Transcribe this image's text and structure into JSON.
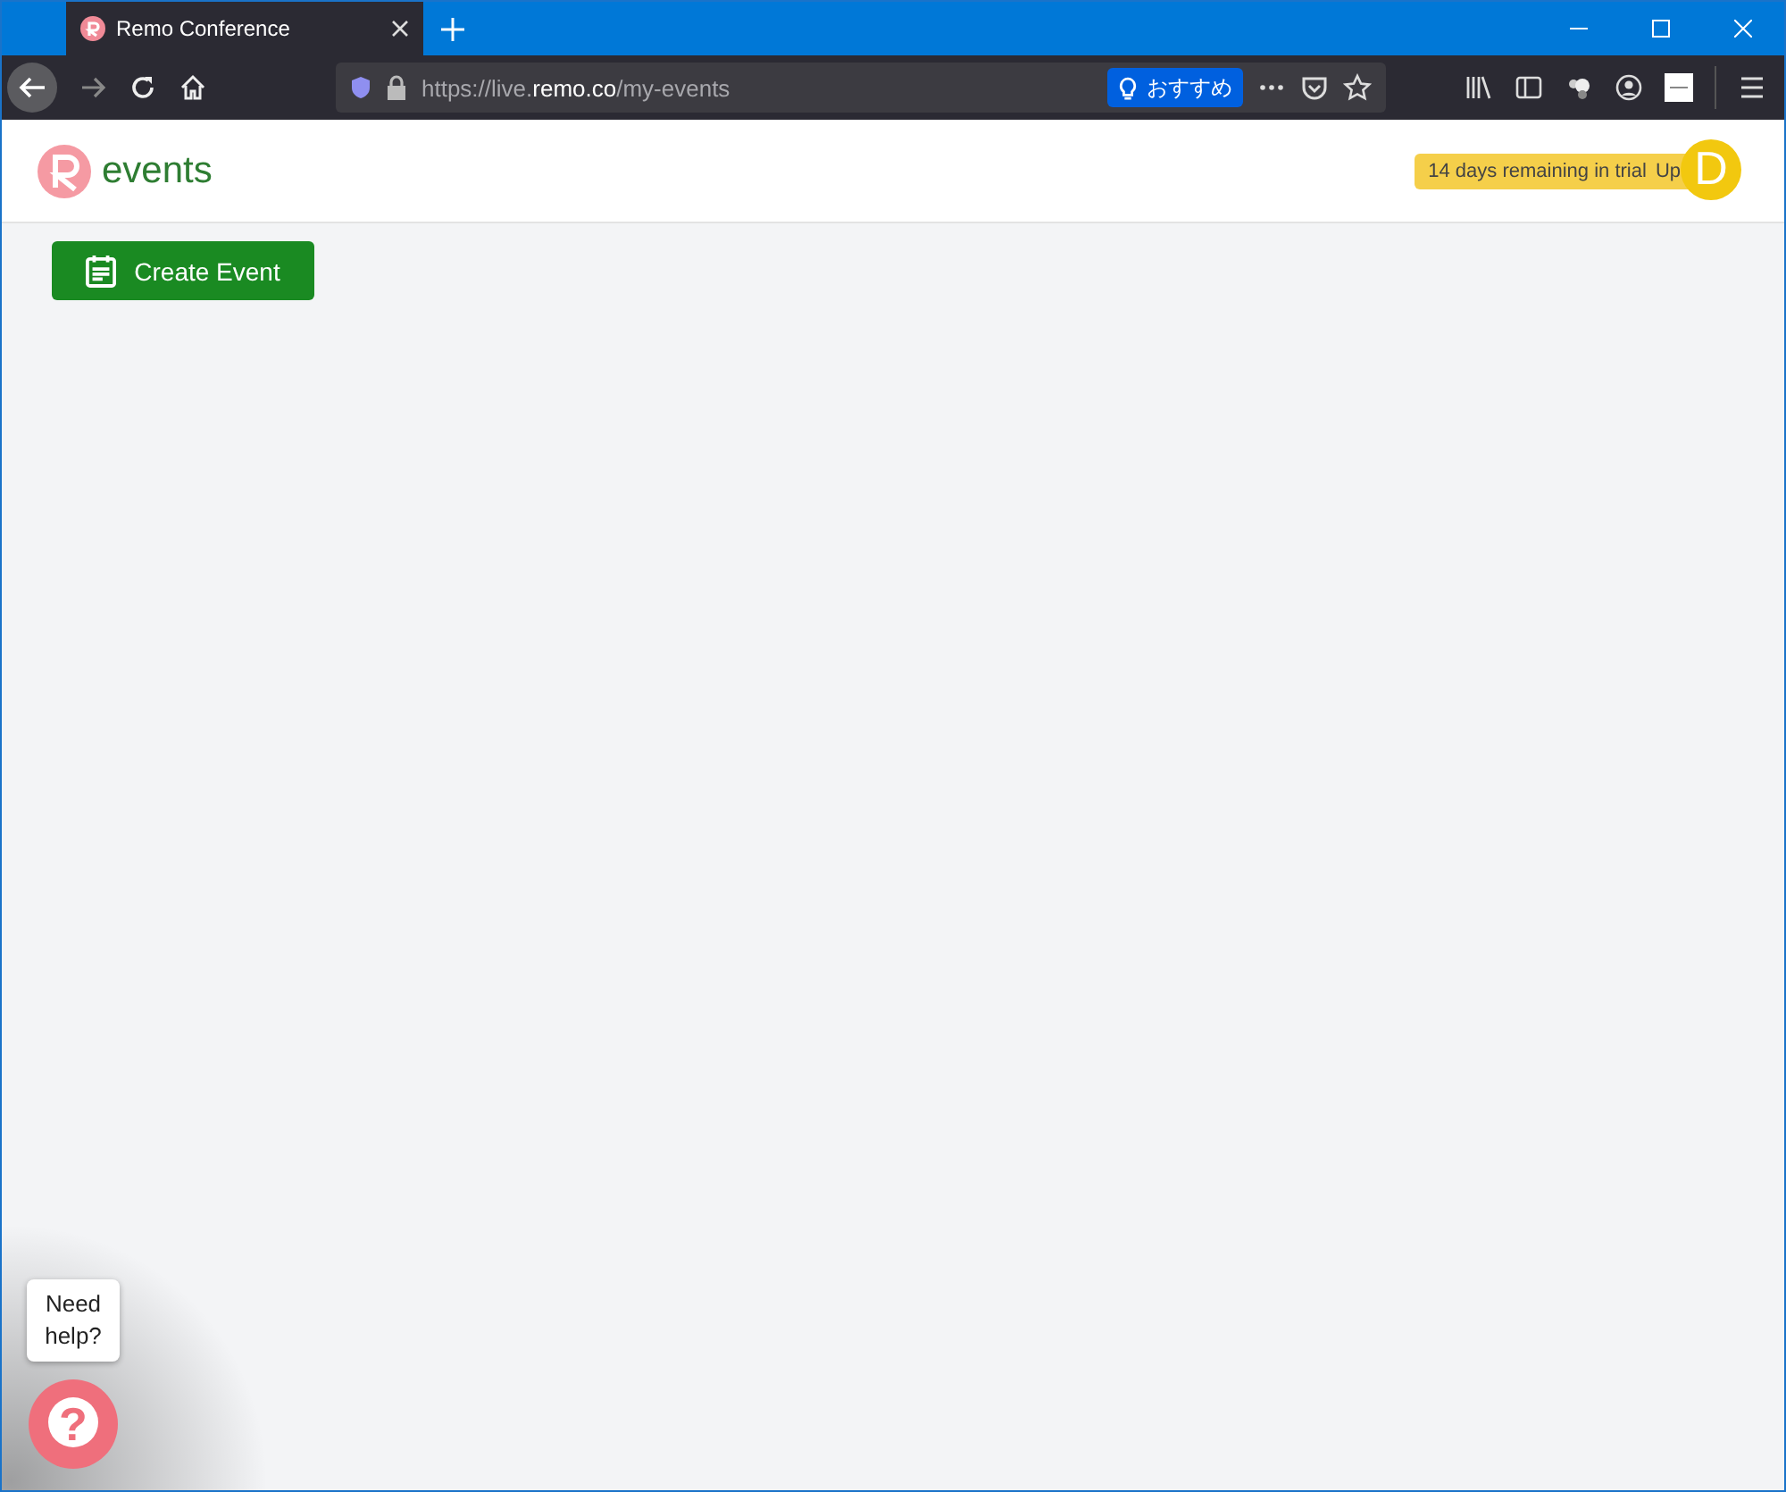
{
  "browser": {
    "tab": {
      "title": "Remo Conference",
      "selected": true
    },
    "address": {
      "prefix": "https://live.",
      "domain": "remo.co",
      "path": "/my-events"
    },
    "suggest_button": "おすすめ"
  },
  "header": {
    "logo_text": "events",
    "trial_badge": "14 days remaining in trial",
    "upgrade_text": "Up",
    "avatar_initial": "D"
  },
  "create_button": "Create Event",
  "help": {
    "bubble": "Need help?",
    "icon": "?"
  }
}
